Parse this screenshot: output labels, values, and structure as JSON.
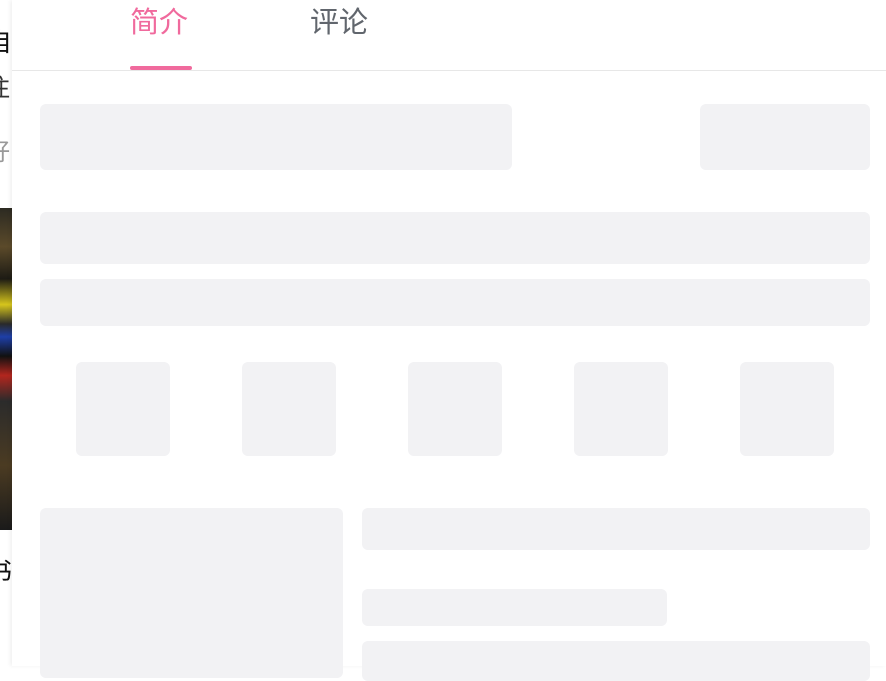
{
  "tabs": [
    {
      "label": "简介",
      "active": true
    },
    {
      "label": "评论",
      "active": false
    }
  ],
  "background_glyphs": [
    "自",
    "注",
    "好",
    "书"
  ],
  "colors": {
    "accent": "#f06a9d",
    "tab_inactive": "#61666d",
    "skeleton": "#f2f2f4",
    "divider": "#e7e7e7"
  }
}
